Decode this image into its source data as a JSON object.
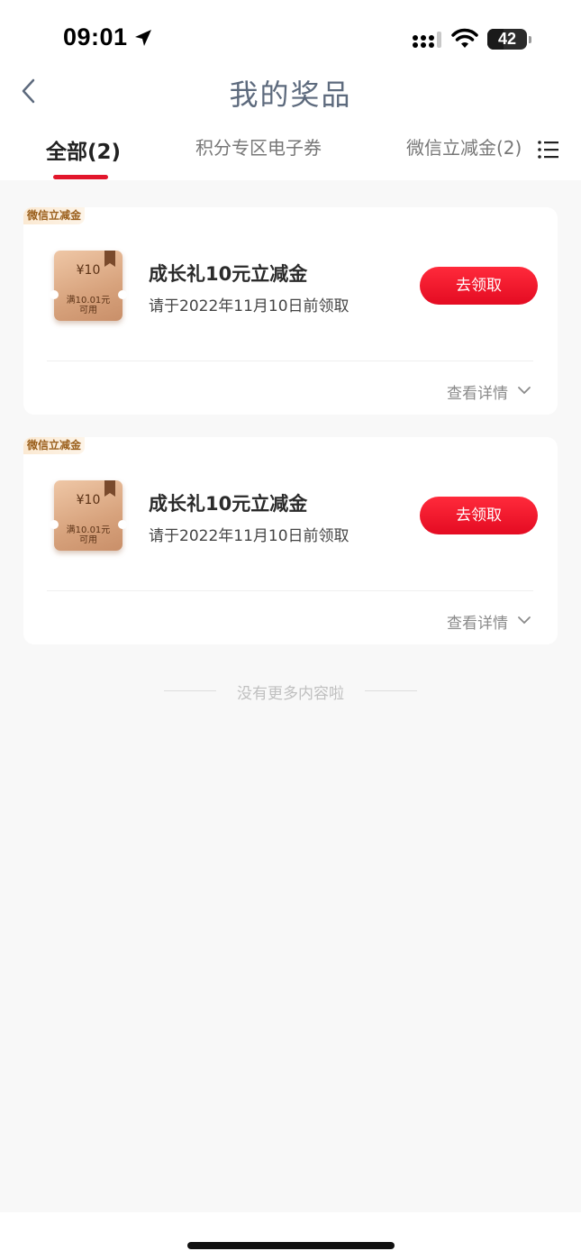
{
  "status_bar": {
    "time": "09:01",
    "battery": "42",
    "icons": [
      "location-arrow-icon",
      "signal-icon",
      "wifi-icon",
      "battery-icon"
    ]
  },
  "header": {
    "title": "我的奖品",
    "back_icon": "chevron-left-icon"
  },
  "tabs": [
    {
      "label": "全部(2)",
      "active": true
    },
    {
      "label": "积分专区电子券",
      "active": false
    },
    {
      "label": "微信立减金(2)",
      "active": false
    }
  ],
  "filter_icon": "list-icon",
  "colors": {
    "accent": "#e2162b",
    "title": "#5d6a7d",
    "tag_text": "#9a5f1c",
    "background": "#f8f8f8"
  },
  "prizes": [
    {
      "tag": "微信立减金",
      "coupon_amount": "¥10",
      "coupon_condition_1": "满10.01元",
      "coupon_condition_2": "可用",
      "title": "成长礼10元立减金",
      "deadline": "请于2022年11月10日前领取",
      "action": "去领取",
      "detail": "查看详情"
    },
    {
      "tag": "微信立减金",
      "coupon_amount": "¥10",
      "coupon_condition_1": "满10.01元",
      "coupon_condition_2": "可用",
      "title": "成长礼10元立减金",
      "deadline": "请于2022年11月10日前领取",
      "action": "去领取",
      "detail": "查看详情"
    }
  ],
  "end_of_list": "没有更多内容啦"
}
